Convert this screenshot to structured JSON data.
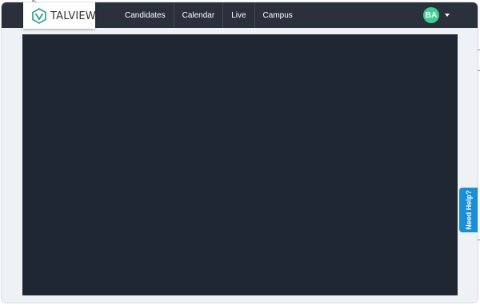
{
  "brand": {
    "logo_text": "TALVIEW",
    "logo_icon": "talview-logo-icon"
  },
  "nav": {
    "items": [
      {
        "label": "Candidates"
      },
      {
        "label": "Calendar"
      },
      {
        "label": "Live"
      },
      {
        "label": "Campus"
      }
    ]
  },
  "user": {
    "initials": "BA",
    "menu_icon": "caret-down-icon"
  },
  "help": {
    "label": "Need Help?"
  },
  "colors": {
    "navbar": "#2b313c",
    "avatar": "#3ecf8e",
    "help_button": "#1a8fd6",
    "content_panel": "#1f2732",
    "page_background": "#eef2f5"
  }
}
